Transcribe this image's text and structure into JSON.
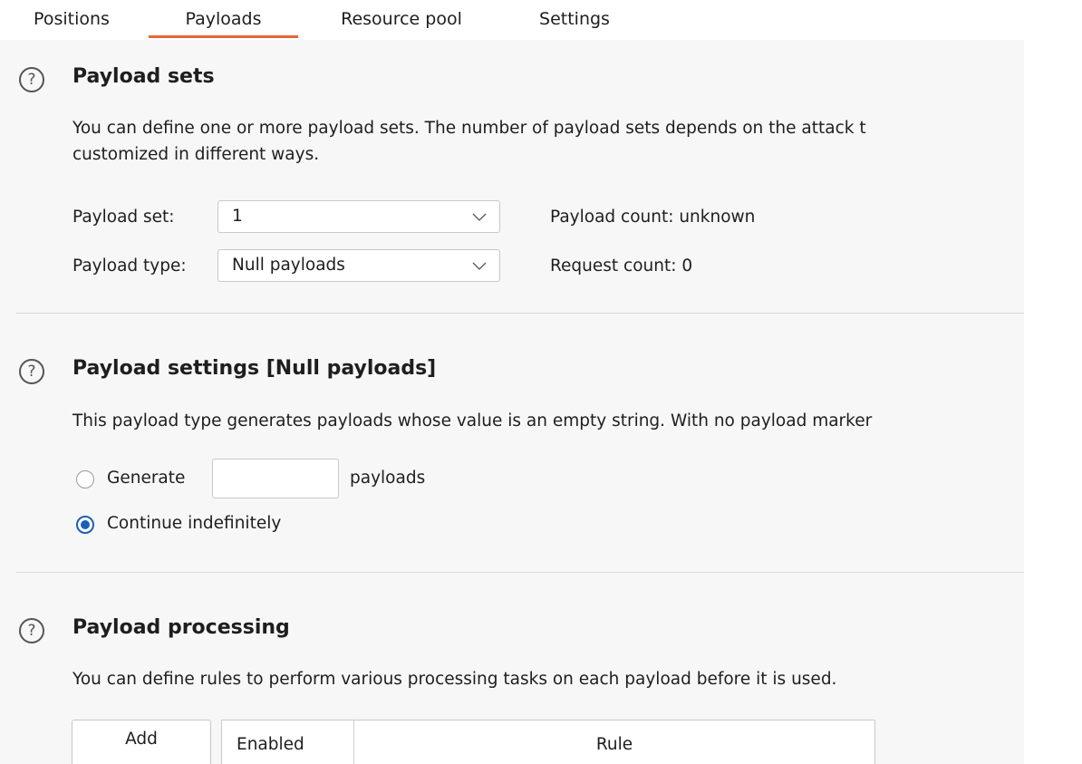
{
  "tabs": [
    {
      "label": "Positions",
      "active": false
    },
    {
      "label": "Payloads",
      "active": true
    },
    {
      "label": "Resource pool",
      "active": false
    },
    {
      "label": "Settings",
      "active": false
    }
  ],
  "accent_color": "#e8663a",
  "radio_color": "#1c5fb7",
  "help_icon": "question-circle-icon",
  "payload_sets": {
    "title": "Payload sets",
    "desc_line1": "You can define one or more payload sets. The number of payload sets depends on the attack t",
    "desc_line2": "customized in different ways.",
    "set_label": "Payload set:",
    "set_value": "1",
    "type_label": "Payload type:",
    "type_value": "Null payloads",
    "payload_count": "Payload count:  unknown",
    "request_count": "Request count: 0"
  },
  "payload_settings": {
    "title": "Payload settings [Null payloads]",
    "desc": "This payload type generates payloads whose value is an empty string. With no payload marker",
    "generate_label": "Generate",
    "generate_value": "",
    "payloads_suffix": "payloads",
    "continue_label": "Continue indefinitely",
    "selected": "continue"
  },
  "payload_processing": {
    "title": "Payload processing",
    "desc": "You can define rules to perform various processing tasks on each payload before it is used.",
    "add_button": "Add",
    "columns": [
      "Enabled",
      "Rule"
    ]
  }
}
